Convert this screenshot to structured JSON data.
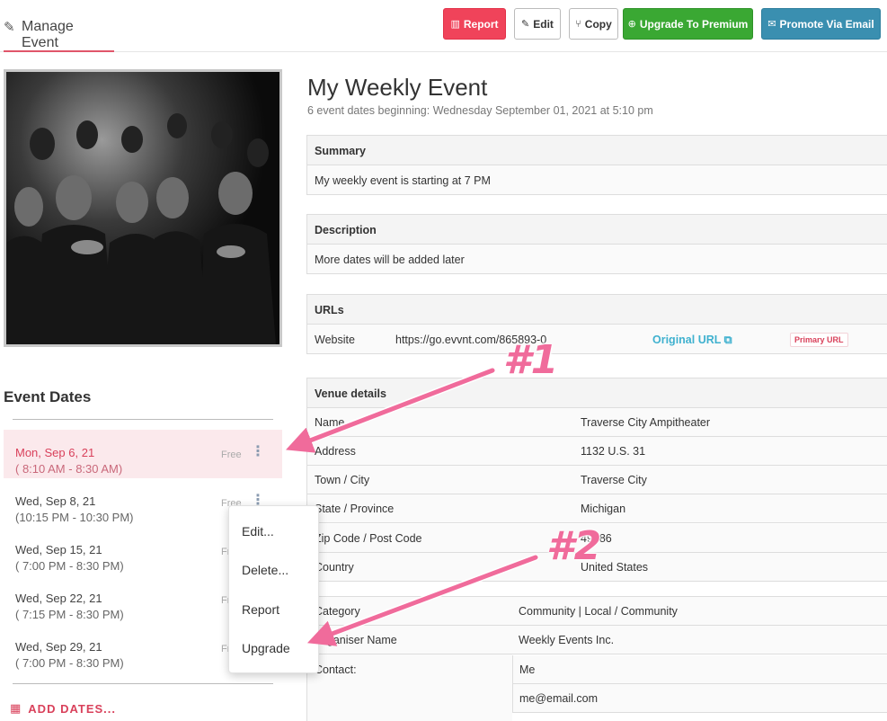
{
  "header": {
    "manage_tab": "Manage Event",
    "buttons": {
      "report": "Report",
      "edit": "Edit",
      "copy": "Copy",
      "upgrade": "Upgrade To Premium",
      "promote": "Promote Via Email"
    }
  },
  "event": {
    "title": "My Weekly Event",
    "subtitle": "6 event dates beginning: Wednesday September 01, 2021 at 5:10 pm"
  },
  "summary": {
    "heading": "Summary",
    "text": "My weekly event is starting at 7 PM"
  },
  "description": {
    "heading": "Description",
    "text": "More dates will be added later"
  },
  "urls": {
    "heading": "URLs",
    "label": "Website",
    "value": "https://go.evvnt.com/865893-0",
    "original_link": "Original URL",
    "badge": "Primary URL"
  },
  "venue": {
    "heading": "Venue details",
    "rows": [
      {
        "k": "Name",
        "v": "Traverse City Ampitheater"
      },
      {
        "k": "Address",
        "v": "1132 U.S. 31"
      },
      {
        "k": "Town / City",
        "v": "Traverse City"
      },
      {
        "k": "State / Province",
        "v": "Michigan"
      },
      {
        "k": "Zip Code / Post Code",
        "v": "49686"
      },
      {
        "k": "Country",
        "v": "United States"
      }
    ]
  },
  "details": {
    "category_label": "Category",
    "category_value": "Community | Local / Community",
    "organiser_label": "Organiser Name",
    "organiser_value": "Weekly Events Inc.",
    "contact_label": "Contact:",
    "contact_name": "Me",
    "contact_email": "me@email.com"
  },
  "event_dates": {
    "title": "Event Dates",
    "items": [
      {
        "date": "Mon, Sep 6, 21",
        "time": "( 8:10 AM - 8:30 AM)",
        "price": "Free"
      },
      {
        "date": "Wed, Sep 8, 21",
        "time": "(10:15 PM - 10:30 PM)",
        "price": "Free"
      },
      {
        "date": "Wed, Sep 15, 21",
        "time": "( 7:00 PM - 8:30 PM)",
        "price": "Free"
      },
      {
        "date": "Wed, Sep 22, 21",
        "time": "( 7:15 PM - 8:30 PM)",
        "price": "Free"
      },
      {
        "date": "Wed, Sep 29, 21",
        "time": "( 7:00 PM - 8:30 PM)",
        "price": "Free"
      }
    ],
    "add_dates": "ADD DATES..."
  },
  "menu": {
    "edit": "Edit...",
    "delete": "Delete...",
    "report": "Report",
    "upgrade": "Upgrade"
  },
  "annotations": {
    "one": "#1",
    "two": "#2"
  },
  "colors": {
    "accent": "#d9415b",
    "annotation": "#f06b9b",
    "green": "#3aa833",
    "blue": "#3a8fb0",
    "red": "#f0435a"
  }
}
